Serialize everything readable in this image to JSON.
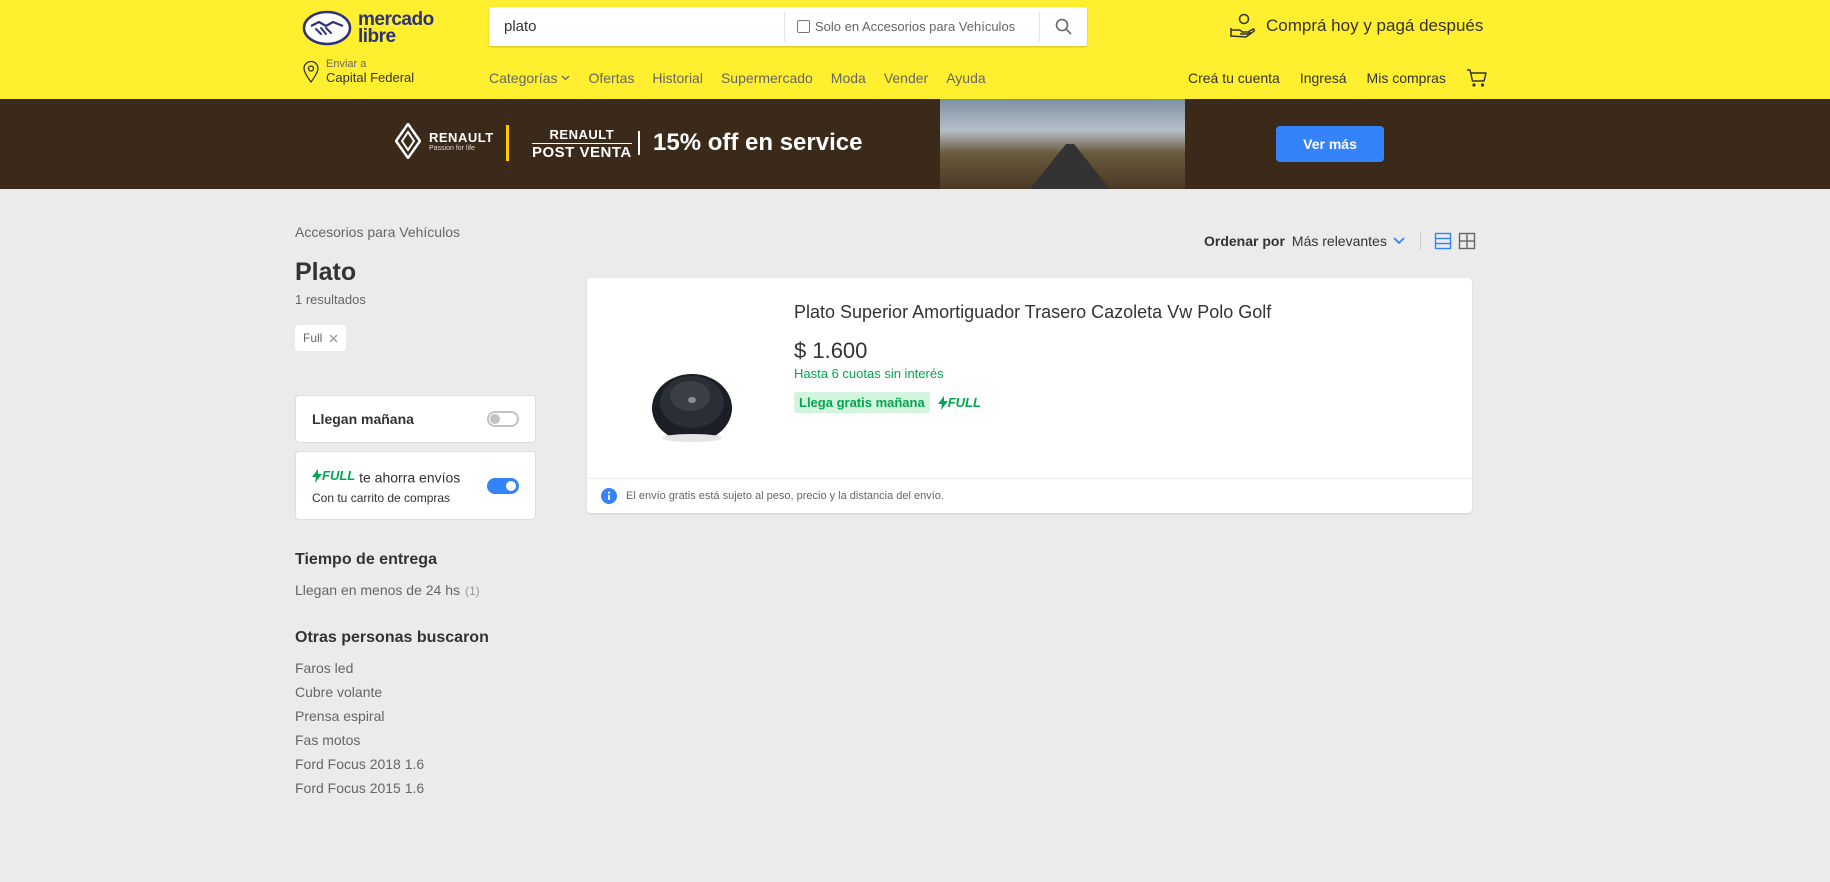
{
  "header": {
    "logo_line1": "mercado",
    "logo_line2": "libre",
    "search": {
      "value": "plato",
      "filter_label": "Solo en Accesorios para Vehículos"
    },
    "promo_text": "Comprá hoy y pagá después",
    "location": {
      "label": "Enviar a",
      "value": "Capital Federal"
    },
    "nav": [
      {
        "label": "Categorías"
      },
      {
        "label": "Ofertas"
      },
      {
        "label": "Historial"
      },
      {
        "label": "Supermercado"
      },
      {
        "label": "Moda"
      },
      {
        "label": "Vender"
      },
      {
        "label": "Ayuda"
      }
    ],
    "user_nav": {
      "create_account": "Creá tu cuenta",
      "login": "Ingresá",
      "purchases": "Mis compras"
    }
  },
  "banner": {
    "brand_name": "RENAULT",
    "brand_tagline": "Passion for life",
    "sub_brand_line1": "RENAULT",
    "sub_brand_line2": "POST VENTA",
    "headline": "15% off en service",
    "cta": "Ver más"
  },
  "sidebar": {
    "breadcrumb": "Accesorios para Vehículos",
    "title": "Plato",
    "results": "1 resultados",
    "applied_filter": "Full",
    "toggles": {
      "tomorrow": {
        "label": "Llegan mañana",
        "on": false
      },
      "full": {
        "badge": "FULL",
        "label": "te ahorra envíos",
        "sub": "Con tu carrito de compras",
        "on": true
      }
    },
    "delivery": {
      "heading": "Tiempo de entrega",
      "option": "Llegan en menos de 24 hs",
      "count": "(1)"
    },
    "related": {
      "heading": "Otras personas buscaron",
      "items": [
        "Faros led",
        "Cubre volante",
        "Prensa espiral",
        "Fas motos",
        "Ford Focus 2018 1.6",
        "Ford Focus 2015 1.6"
      ]
    }
  },
  "sort": {
    "label": "Ordenar por",
    "value": "Más relevantes"
  },
  "results": [
    {
      "title": "Plato Superior Amortiguador Trasero Cazoleta Vw Polo Golf",
      "price": "$ 1.600",
      "installments": "Hasta 6 cuotas sin interés",
      "shipping": "Llega gratis mañana",
      "full_badge": "FULL",
      "footer_note": "El envío gratis está sujeto al peso, precio y la distancia del envío."
    }
  ],
  "colors": {
    "header_bg": "#ffef2e",
    "accent_blue": "#3483fa",
    "success_green": "#00a650",
    "page_bg": "#ebebeb"
  }
}
